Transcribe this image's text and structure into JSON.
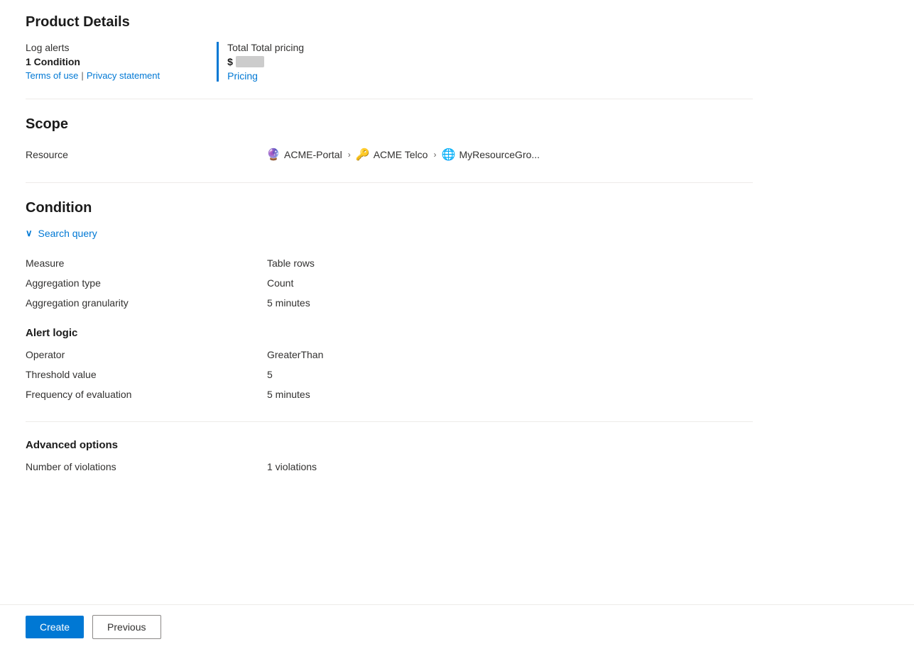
{
  "productDetails": {
    "title": "Product Details",
    "logAlertsLabel": "Log alerts",
    "conditionLabel": "1 Condition",
    "termsLink": "Terms of use",
    "separatorText": "|",
    "privacyLink": "Privacy statement",
    "totalPricingLabel": "Total Total pricing",
    "priceSymbol": "$",
    "priceBlurred": "●●●",
    "pricingLink": "Pricing"
  },
  "scope": {
    "sectionTitle": "Scope",
    "resourceLabel": "Resource",
    "chain": [
      {
        "name": "ACME-Portal",
        "icon": "🔮"
      },
      {
        "name": "ACME Telco",
        "icon": "🔑"
      },
      {
        "name": "MyResourceGro...",
        "icon": "🌐"
      }
    ]
  },
  "condition": {
    "sectionTitle": "Condition",
    "searchQueryLabel": "Search query",
    "measureLabel": "Measure",
    "measureValue": "Table rows",
    "aggregationTypeLabel": "Aggregation type",
    "aggregationTypeValue": "Count",
    "aggregationGranularityLabel": "Aggregation granularity",
    "aggregationGranularityValue": "5 minutes"
  },
  "alertLogic": {
    "sectionTitle": "Alert logic",
    "operatorLabel": "Operator",
    "operatorValue": "GreaterThan",
    "thresholdLabel": "Threshold value",
    "thresholdValue": "5",
    "frequencyLabel": "Frequency of evaluation",
    "frequencyValue": "5 minutes"
  },
  "advancedOptions": {
    "sectionTitle": "Advanced options",
    "numberOfViolationsLabel": "Number of violations",
    "numberOfViolationsValue": "1 violations"
  },
  "footer": {
    "createLabel": "Create",
    "previousLabel": "Previous"
  }
}
